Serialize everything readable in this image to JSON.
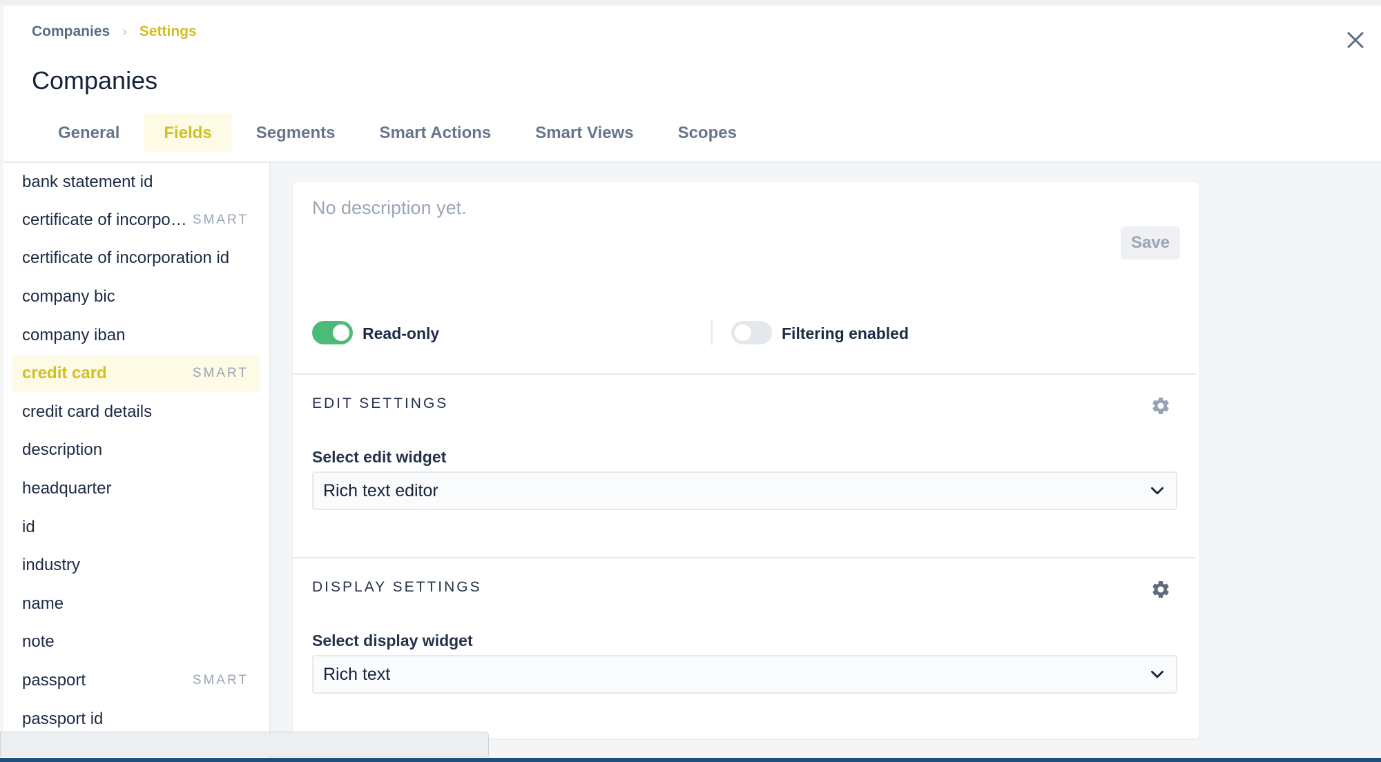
{
  "breadcrumb": {
    "root": "Companies",
    "separator": "›",
    "current": "Settings"
  },
  "page_title": "Companies",
  "tabs": [
    {
      "label": "General",
      "active": false
    },
    {
      "label": "Fields",
      "active": true
    },
    {
      "label": "Segments",
      "active": false
    },
    {
      "label": "Smart Actions",
      "active": false
    },
    {
      "label": "Smart Views",
      "active": false
    },
    {
      "label": "Scopes",
      "active": false
    }
  ],
  "fields": [
    {
      "name": "bank statement id",
      "badge": ""
    },
    {
      "name": "certificate of incorporation",
      "badge": "SMART"
    },
    {
      "name": "certificate of incorporation id",
      "badge": ""
    },
    {
      "name": "company bic",
      "badge": ""
    },
    {
      "name": "company iban",
      "badge": ""
    },
    {
      "name": "credit card",
      "badge": "SMART",
      "active": true
    },
    {
      "name": "credit card details",
      "badge": ""
    },
    {
      "name": "description",
      "badge": ""
    },
    {
      "name": "headquarter",
      "badge": ""
    },
    {
      "name": "id",
      "badge": ""
    },
    {
      "name": "industry",
      "badge": ""
    },
    {
      "name": "name",
      "badge": ""
    },
    {
      "name": "note",
      "badge": ""
    },
    {
      "name": "passport",
      "badge": "SMART"
    },
    {
      "name": "passport id",
      "badge": ""
    }
  ],
  "description": {
    "placeholder": "No description yet.",
    "save_label": "Save"
  },
  "toggles": {
    "read_only": {
      "label": "Read-only",
      "enabled": true
    },
    "filtering": {
      "label": "Filtering enabled",
      "enabled": false
    }
  },
  "edit_settings": {
    "title": "EDIT SETTINGS",
    "select_label": "Select edit widget",
    "selected": "Rich text editor"
  },
  "display_settings": {
    "title": "DISPLAY SETTINGS",
    "select_label": "Select display widget",
    "selected": "Rich text"
  },
  "colors": {
    "accent": "#d1bf23",
    "toggle_on": "#4dbb77",
    "text": "#1b2b45"
  },
  "icons": {
    "close": "close-icon",
    "gear": "gear-icon",
    "chevron": "chevron-down-icon",
    "breadcrumb_separator": "chevron-right-icon"
  }
}
